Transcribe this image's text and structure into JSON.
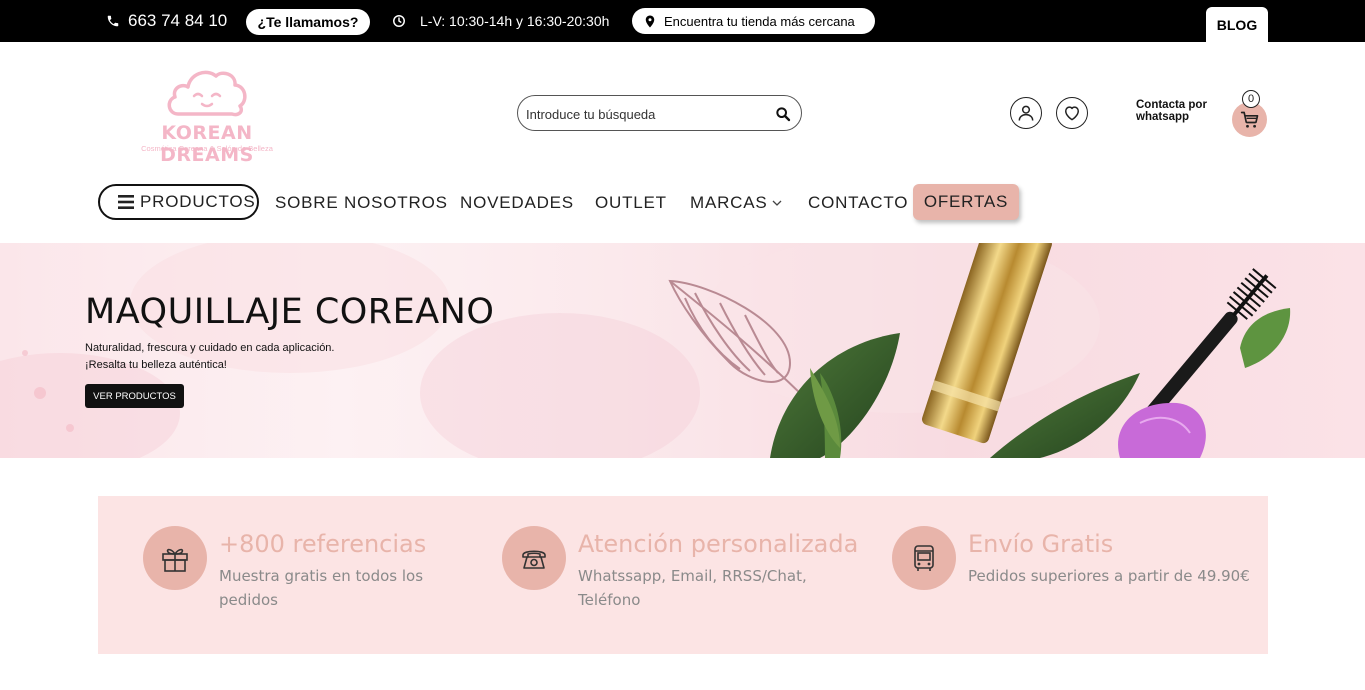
{
  "topbar": {
    "phone": "663 74 84 10",
    "call_button": "¿Te llamamos?",
    "hours": "L-V: 10:30-14h y 16:30-20:30h",
    "store_button": "Encuentra tu tienda más cercana",
    "blog_tab": "BLOG"
  },
  "logo": {
    "title": "KOREAN DREAMS",
    "subtitle": "Cosmética Coreana & Salón de Belleza"
  },
  "search": {
    "placeholder": "Introduce tu búsqueda"
  },
  "header": {
    "whatsapp_text": "Contacta por whatsapp",
    "cart_count": "0"
  },
  "nav": {
    "products": "PRODUCTOS",
    "about": "SOBRE NOSOTROS",
    "news": "NOVEDADES",
    "outlet": "OUTLET",
    "brands": "MARCAS",
    "contact": "CONTACTO",
    "offers": "OFERTAS"
  },
  "banner": {
    "title": "MAQUILLAJE COREANO",
    "line1": "Naturalidad, frescura y cuidado en cada aplicación.",
    "line2": "¡Resalta tu belleza auténtica!",
    "cta": "VER PRODUCTOS"
  },
  "features": [
    {
      "icon": "gift-icon",
      "title": "+800 referencias",
      "desc": "Muestra gratis en todos los pedidos"
    },
    {
      "icon": "telephone-icon",
      "title": "Atención personalizada",
      "desc": "Whatssapp, Email, RRSS/Chat, Teléfono"
    },
    {
      "icon": "bus-icon",
      "title": "Envío Gratis",
      "desc": "Pedidos superiores a partir de 49.90€"
    }
  ],
  "colors": {
    "accent": "#e8b4aa",
    "logo_pink": "#f4b6c7",
    "features_bg": "#fce4e4",
    "topbar_bg": "#000000"
  }
}
